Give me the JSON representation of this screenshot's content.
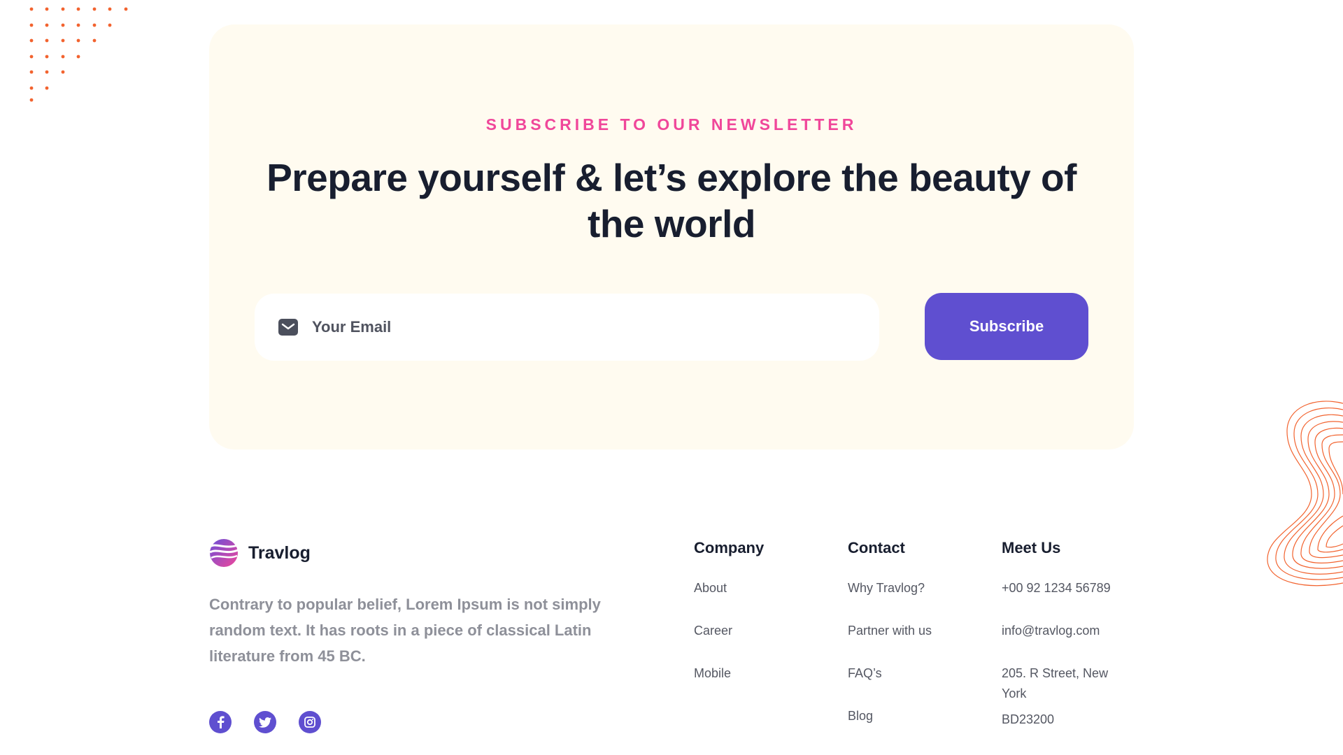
{
  "newsletter": {
    "eyebrow": "SUBSCRIBE TO OUR NEWSLETTER",
    "title": "Prepare yourself & let’s explore the beauty of the world",
    "email_placeholder": "Your Email",
    "email_icon": "mail-icon",
    "subscribe_label": "Subscribe"
  },
  "footer": {
    "brand": {
      "name": "Travlog",
      "logo_icon": "travlog-logo",
      "description": "Contrary to popular belief, Lorem Ipsum is not simply random text. It has roots in a piece of classical Latin literature from 45 BC."
    },
    "socials": [
      "facebook-icon",
      "twitter-icon",
      "instagram-icon"
    ],
    "columns": {
      "company": {
        "title": "Company",
        "items": [
          "About",
          "Career",
          "Mobile"
        ]
      },
      "contact": {
        "title": "Contact",
        "items": [
          "Why Travlog?",
          "Partner with us",
          "FAQ’s",
          "Blog"
        ]
      },
      "meet_us": {
        "title": "Meet Us",
        "items": [
          "+00 92 1234 56789",
          "info@travlog.com",
          "205. R Street, New York",
          "BD23200"
        ]
      }
    }
  },
  "colors": {
    "accent_pink": "#f0479a",
    "primary_purple": "#5f4fd0",
    "card_background": "#fffbf0",
    "decor_orange": "#f2632f"
  }
}
